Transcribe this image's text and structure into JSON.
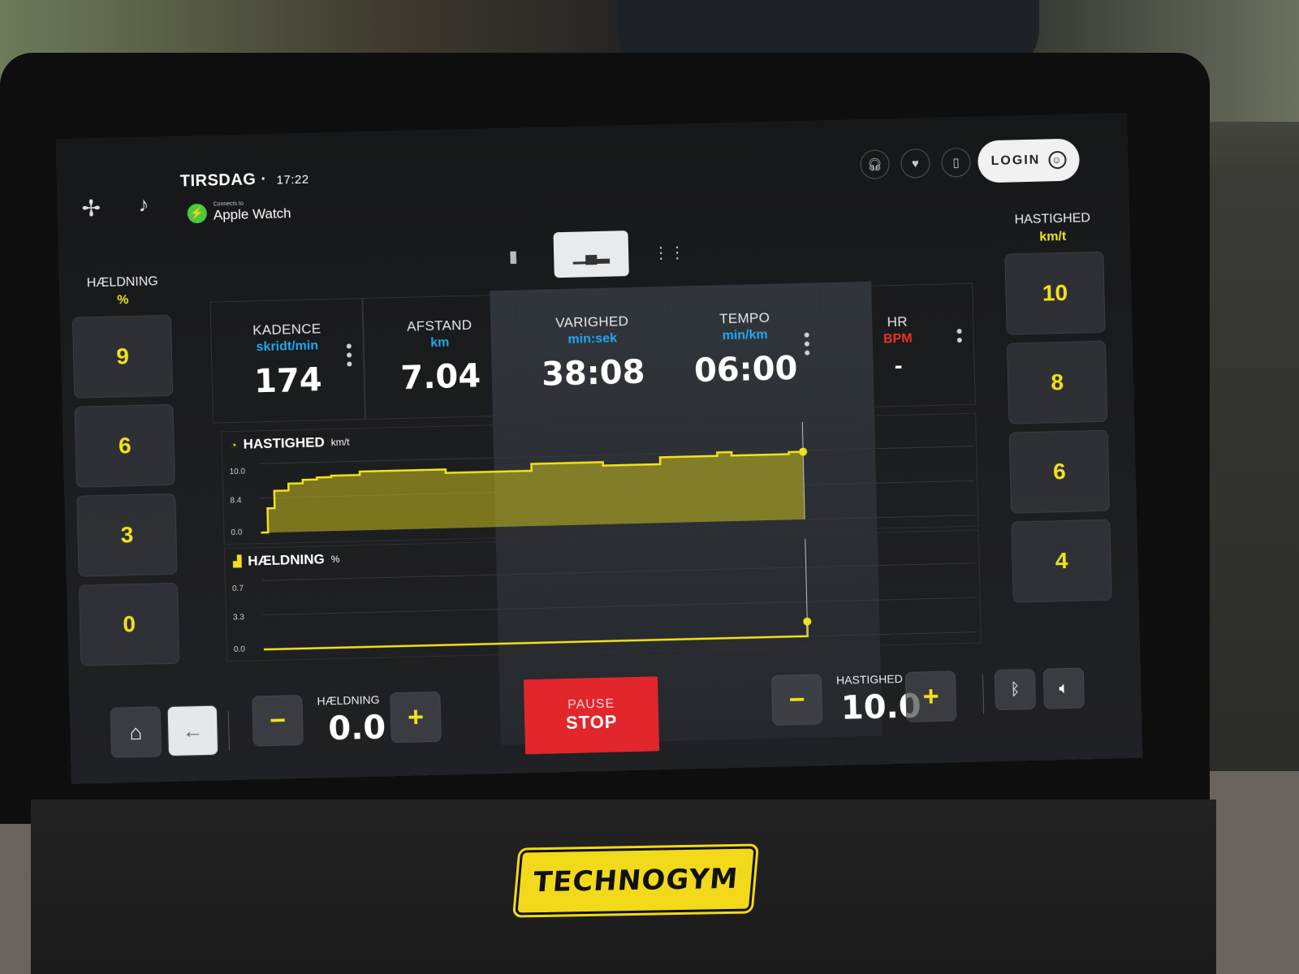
{
  "header": {
    "day": "TIRSDAG",
    "separator": "·",
    "time": "17:22",
    "connect_small": "Connects to",
    "connect_device": "Apple Watch",
    "login_label": "LOGIN"
  },
  "icons": {
    "fan": "fan-icon",
    "music": "music-icon",
    "headphones": "headphones-icon",
    "heart": "heart-icon",
    "phone": "phone-icon",
    "user": "user-icon",
    "home": "home-icon",
    "back": "back-arrow-icon",
    "bluetooth": "bluetooth-icon",
    "volume": "volume-icon"
  },
  "left_panel": {
    "title": "HÆLDNING",
    "unit": "%",
    "presets": [
      "9",
      "6",
      "3",
      "0"
    ]
  },
  "right_panel": {
    "title": "HASTIGHED",
    "unit": "km/t",
    "presets": [
      "10",
      "8",
      "6",
      "4"
    ]
  },
  "metrics": [
    {
      "label": "KADENCE",
      "unit": "skridt/min",
      "value": "174",
      "unit_color": "#1ea8f2"
    },
    {
      "label": "AFSTAND",
      "unit": "km",
      "value": "7.04",
      "unit_color": "#1ea8f2"
    },
    {
      "label": "VARIGHED",
      "unit": "min:sek",
      "value": "38:08",
      "unit_color": "#1ea8f2"
    },
    {
      "label": "TEMPO",
      "unit": "min/km",
      "value": "06:00",
      "unit_color": "#1ea8f2"
    },
    {
      "label": "HR",
      "unit": "BPM",
      "value": "-",
      "unit_color": "#e8352c"
    }
  ],
  "charts": {
    "speed": {
      "title": "HASTIGHED",
      "unit": "km/t",
      "ticks": [
        "10.0",
        "8.4",
        "0.0"
      ]
    },
    "incline": {
      "title": "HÆLDNING",
      "unit": "%",
      "ticks": [
        "0.7",
        "3.3",
        "0.0"
      ]
    }
  },
  "chart_data": [
    {
      "type": "area",
      "title": "HASTIGHED",
      "ylabel": "km/t",
      "ylim": [
        0,
        10.0
      ],
      "x": [
        0,
        0.5,
        1,
        2,
        3,
        4,
        5,
        6,
        7,
        8,
        9,
        10,
        11,
        12,
        13,
        14,
        15,
        16,
        17,
        18,
        19,
        20,
        21,
        22,
        23,
        24,
        25,
        26,
        27,
        28,
        29,
        30,
        31,
        32,
        33,
        34,
        35,
        36,
        37,
        38
      ],
      "series": [
        {
          "values": [
            0.0,
            3.5,
            6.0,
            7.0,
            7.5,
            7.8,
            8.0,
            8.0,
            8.5,
            8.5,
            8.5,
            8.5,
            8.5,
            8.5,
            8.0,
            8.0,
            8.0,
            8.0,
            8.0,
            8.0,
            9.0,
            9.0,
            9.0,
            9.0,
            9.0,
            8.5,
            8.5,
            8.5,
            8.5,
            9.5,
            9.5,
            9.5,
            9.5,
            10.0,
            9.5,
            9.5,
            9.5,
            9.5,
            9.8,
            9.8
          ]
        }
      ]
    },
    {
      "type": "line",
      "title": "HÆLDNING",
      "ylabel": "%",
      "ylim": [
        0,
        3.3
      ],
      "x": [
        0,
        38
      ],
      "series": [
        {
          "values": [
            0.0,
            0.7
          ]
        }
      ]
    }
  ],
  "controls": {
    "incline_label": "HÆLDNING",
    "incline_value": "0.0",
    "speed_label": "HASTIGHED",
    "speed_value": "10.0",
    "minus": "−",
    "plus": "+",
    "pause_label": "PAUSE",
    "stop_label": "STOP"
  },
  "brand": "TECHNOGYM",
  "colors": {
    "accent": "#f2e21c",
    "unit_blue": "#1ea8f2",
    "stop_red": "#e1262c"
  }
}
